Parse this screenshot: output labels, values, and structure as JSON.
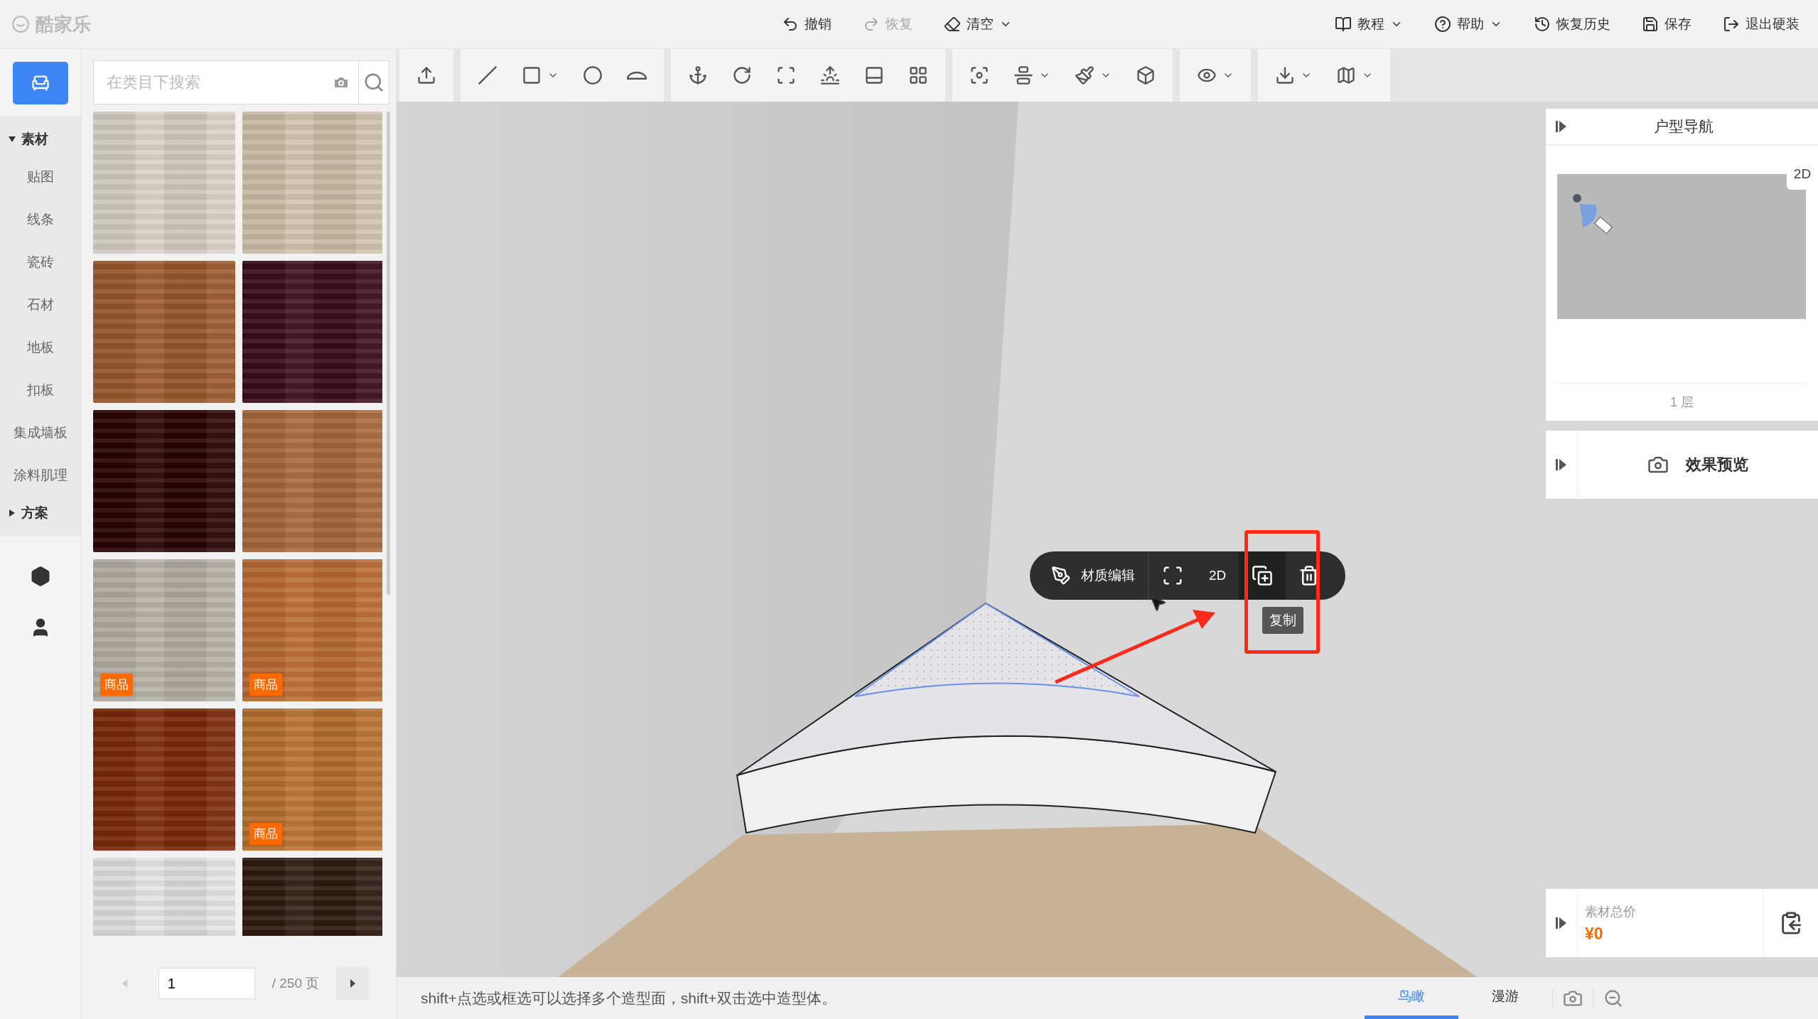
{
  "app_title": "酷家乐",
  "top_actions": [
    {
      "label": "撤销",
      "kind": "undo",
      "disabled": false,
      "dropdown": false
    },
    {
      "label": "恢复",
      "kind": "redo",
      "disabled": true,
      "dropdown": false
    },
    {
      "label": "清空",
      "kind": "eraser",
      "disabled": false,
      "dropdown": true
    }
  ],
  "top_right_actions": [
    {
      "label": "教程",
      "kind": "book",
      "dropdown": true
    },
    {
      "label": "帮助",
      "kind": "help",
      "dropdown": true
    },
    {
      "label": "恢复历史",
      "kind": "history",
      "dropdown": false
    },
    {
      "label": "保存",
      "kind": "save",
      "dropdown": false
    },
    {
      "label": "退出硬装",
      "kind": "exit",
      "dropdown": false
    }
  ],
  "categories": [
    {
      "label": "素材",
      "expanded": true,
      "children": [
        {
          "label": "贴图"
        },
        {
          "label": "线条"
        },
        {
          "label": "瓷砖"
        },
        {
          "label": "石材"
        },
        {
          "label": "地板"
        },
        {
          "label": "扣板"
        },
        {
          "label": "集成墙板"
        },
        {
          "label": "涂料肌理"
        }
      ]
    },
    {
      "label": "方案",
      "expanded": false
    }
  ],
  "search": {
    "placeholder": "在类目下搜索"
  },
  "materials": [
    {
      "color": "#d8d2c8"
    },
    {
      "color": "#cfc3ab"
    },
    {
      "color": "#9c5a2c"
    },
    {
      "color": "#3c0d1c"
    },
    {
      "color": "#2a0406"
    },
    {
      "color": "#a9683a"
    },
    {
      "color": "#b6b1a7",
      "badge": "商品"
    },
    {
      "color": "#bb6b34",
      "badge": "商品"
    },
    {
      "color": "#7c2a0b"
    },
    {
      "color": "#b8712f",
      "badge": "商品"
    },
    {
      "color": "#e4e4e4"
    },
    {
      "color": "#2f1b13"
    }
  ],
  "pagination": {
    "page": "1",
    "total": "/ 250 页",
    "prev_disabled": true
  },
  "toolbar_groups": [
    [
      {
        "kind": "upload",
        "dropdown": false
      }
    ],
    [
      {
        "kind": "line",
        "dropdown": false
      },
      {
        "kind": "rectangle",
        "dropdown": true
      },
      {
        "kind": "circle",
        "dropdown": false
      },
      {
        "kind": "arch",
        "dropdown": false
      }
    ],
    [
      {
        "kind": "anchor",
        "dropdown": false
      },
      {
        "kind": "rotate",
        "dropdown": false
      },
      {
        "kind": "frame",
        "dropdown": false
      },
      {
        "kind": "light",
        "dropdown": false
      },
      {
        "kind": "panel",
        "dropdown": false
      },
      {
        "kind": "grid",
        "dropdown": false
      }
    ],
    [
      {
        "kind": "focus",
        "dropdown": false
      },
      {
        "kind": "align",
        "dropdown": true
      },
      {
        "kind": "brush",
        "dropdown": true
      },
      {
        "kind": "cube",
        "dropdown": false
      }
    ],
    [
      {
        "kind": "eye",
        "dropdown": true
      }
    ],
    [
      {
        "kind": "download",
        "dropdown": true
      },
      {
        "kind": "map",
        "dropdown": true
      }
    ]
  ],
  "floating_toolbar": {
    "material_edit": "材质编辑",
    "view_2d": "2D",
    "copy_highlighted": true,
    "tooltip": "复制"
  },
  "house_nav": {
    "title": "户型导航",
    "view_button": "2D",
    "floor": "1 层"
  },
  "preview": {
    "title": "效果预览"
  },
  "price": {
    "label": "素材总价",
    "value": "¥0"
  },
  "status": {
    "hint": "shift+点选或框选可以选择多个造型面，shift+双击选中造型体。"
  },
  "view_tabs": [
    {
      "label": "鸟瞰",
      "selected": true
    },
    {
      "label": "漫游",
      "selected": false
    }
  ]
}
